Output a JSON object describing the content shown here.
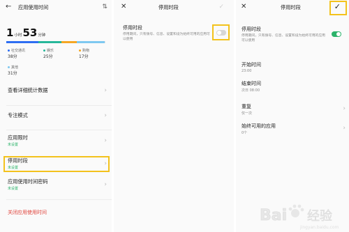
{
  "panel1": {
    "title": "应用使用时间",
    "usage": {
      "hours": "1",
      "hours_unit": "小时",
      "minutes": "53",
      "minutes_unit": "分钟"
    },
    "usage_segments": [
      {
        "fraction": 0.33,
        "color": "#2e6ef2"
      },
      {
        "fraction": 0.24,
        "color": "#27b79a"
      },
      {
        "fraction": 0.16,
        "color": "#f5a623"
      },
      {
        "fraction": 0.29,
        "color": "#7ec8f0"
      }
    ],
    "categories": [
      {
        "name": "社交通讯",
        "value": "38分",
        "color": "#2e6ef2"
      },
      {
        "name": "娱乐",
        "value": "25分",
        "color": "#27b79a"
      },
      {
        "name": "购物",
        "value": "17分",
        "color": "#f5a623"
      },
      {
        "name": "其他",
        "value": "31分",
        "color": "#7ec8f0"
      }
    ],
    "items": [
      {
        "label": "查看详细统计数据",
        "sub": ""
      },
      {
        "label": "专注模式",
        "sub": ""
      },
      {
        "label": "应用限时",
        "sub": "未设置"
      },
      {
        "label": "停用时段",
        "sub": "未设置"
      },
      {
        "label": "应用使用时间密码",
        "sub": "未设置"
      }
    ],
    "close_label": "关闭应用使用时间"
  },
  "panel2": {
    "title": "停用时段",
    "section_label": "停用时段",
    "description": "停用期间，只有拨号、信息、设置和设为始终可用的应用可以使用",
    "toggle_on": false
  },
  "panel3": {
    "title": "停用时段",
    "section_label": "停用时段",
    "description": "停用期间，只有拨号、信息、设置和设为始终可用的应用可以使用",
    "toggle_on": true,
    "settings": [
      {
        "label": "开始时间",
        "value": "23:00",
        "chevron": false
      },
      {
        "label": "结束时间",
        "value": "次日 08:00",
        "chevron": false
      },
      {
        "label": "重复",
        "value": "仅一次",
        "chevron": true
      },
      {
        "label": "始终可用的应用",
        "value": "0个",
        "chevron": true
      }
    ]
  },
  "colors": {
    "accent_green": "#2bb36a",
    "highlight_yellow": "#f3c21c",
    "danger_red": "#e0443c"
  },
  "watermark": {
    "text": "Bai 经验",
    "url": "jingyan.baidu.com"
  }
}
